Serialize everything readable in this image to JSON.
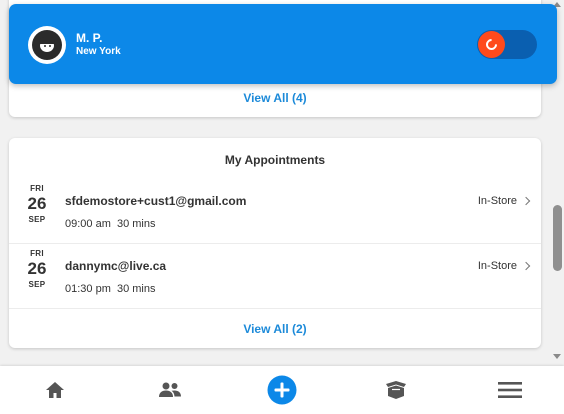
{
  "profile": {
    "name": "M. P.",
    "city": "New York",
    "toggle_state": "on"
  },
  "top_card": {
    "view_all_label": "View All (4)"
  },
  "appointments": {
    "title": "My Appointments",
    "items": [
      {
        "dow": "FRI",
        "day": "26",
        "month": "SEP",
        "email": "sfdemostore+cust1@gmail.com",
        "time": "09:00 am  30 mins",
        "type": "In-Store"
      },
      {
        "dow": "FRI",
        "day": "26",
        "month": "SEP",
        "email": "dannymc@live.ca",
        "time": "01:30 pm  30 mins",
        "type": "In-Store"
      }
    ],
    "view_all_label": "View All (2)"
  },
  "nav": {
    "items": [
      "home-icon",
      "customers-icon",
      "add-icon",
      "box-icon",
      "menu-icon"
    ]
  },
  "colors": {
    "accent": "#0c88e8",
    "link": "#1c8ad9",
    "toggle_knob": "#ff4a1c"
  }
}
